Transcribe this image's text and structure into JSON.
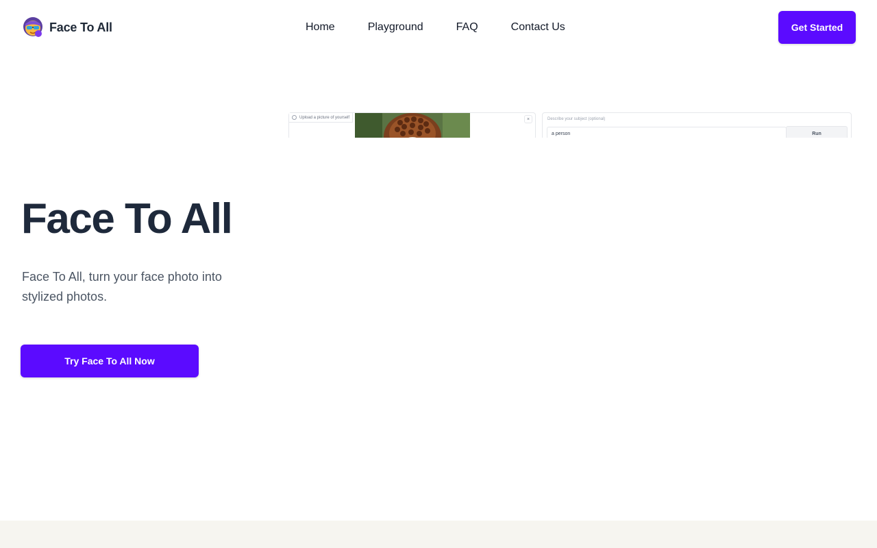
{
  "header": {
    "brand_name": "Face To All",
    "nav": [
      "Home",
      "Playground",
      "FAQ",
      "Contact Us"
    ],
    "cta_label": "Get Started"
  },
  "demo": {
    "upload_label": "Upload a picture of yourself",
    "close_glyph": "×",
    "describe_label": "Describe your subject (optional)",
    "describe_value": "a person",
    "run_label": "Run"
  },
  "hero": {
    "title": "Face To All",
    "subtitle": "Face To All, turn your face photo into stylized photos.",
    "cta_label": "Try Face To All Now"
  },
  "colors": {
    "accent": "#5b0bff",
    "title": "#1e293b",
    "footer_band": "#f6f5f0"
  },
  "icons": {
    "logo": "emoji-face-with-sunglasses-logo",
    "upload": "image-icon",
    "close": "close-icon"
  }
}
